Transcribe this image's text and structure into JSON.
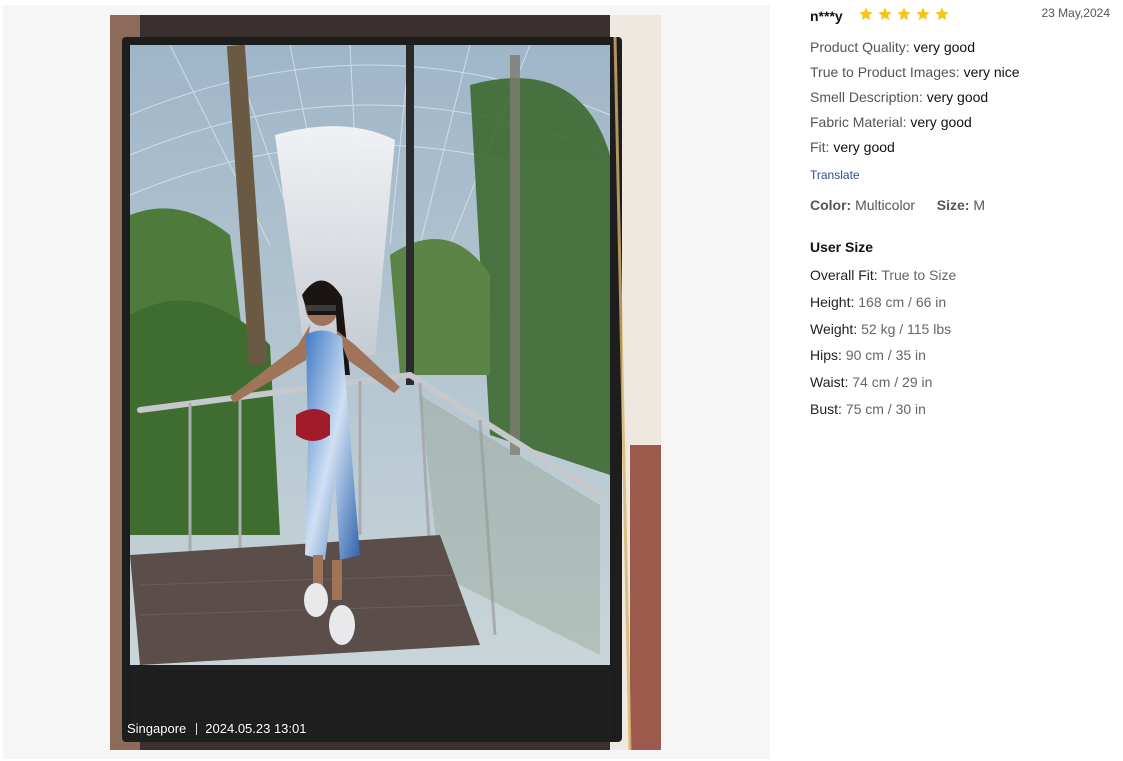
{
  "photo": {
    "location": "Singapore",
    "timestamp": "2024.05.23 13:01"
  },
  "review": {
    "username": "n***y",
    "rating": 5,
    "rating_max": 5,
    "star_color": "#f5c518",
    "date": "23 May,2024",
    "attributes": [
      {
        "key": "Product Quality:",
        "value": "very good"
      },
      {
        "key": "True to Product Images:",
        "value": "very nice"
      },
      {
        "key": "Smell Description:",
        "value": "very good"
      },
      {
        "key": "Fabric Material:",
        "value": "very good"
      },
      {
        "key": "Fit:",
        "value": "very good"
      }
    ],
    "translate_label": "Translate",
    "color_label": "Color:",
    "color_value": "Multicolor",
    "size_label": "Size:",
    "size_value": "M"
  },
  "user_size": {
    "title": "User Size",
    "rows": [
      {
        "key": "Overall Fit:",
        "value": "True to Size"
      },
      {
        "key": "Height:",
        "value": "168 cm / 66 in"
      },
      {
        "key": "Weight:",
        "value": "52 kg / 115 lbs"
      },
      {
        "key": "Hips:",
        "value": "90 cm / 35 in"
      },
      {
        "key": "Waist:",
        "value": "74 cm / 29 in"
      },
      {
        "key": "Bust:",
        "value": "75 cm / 30 in"
      }
    ]
  }
}
